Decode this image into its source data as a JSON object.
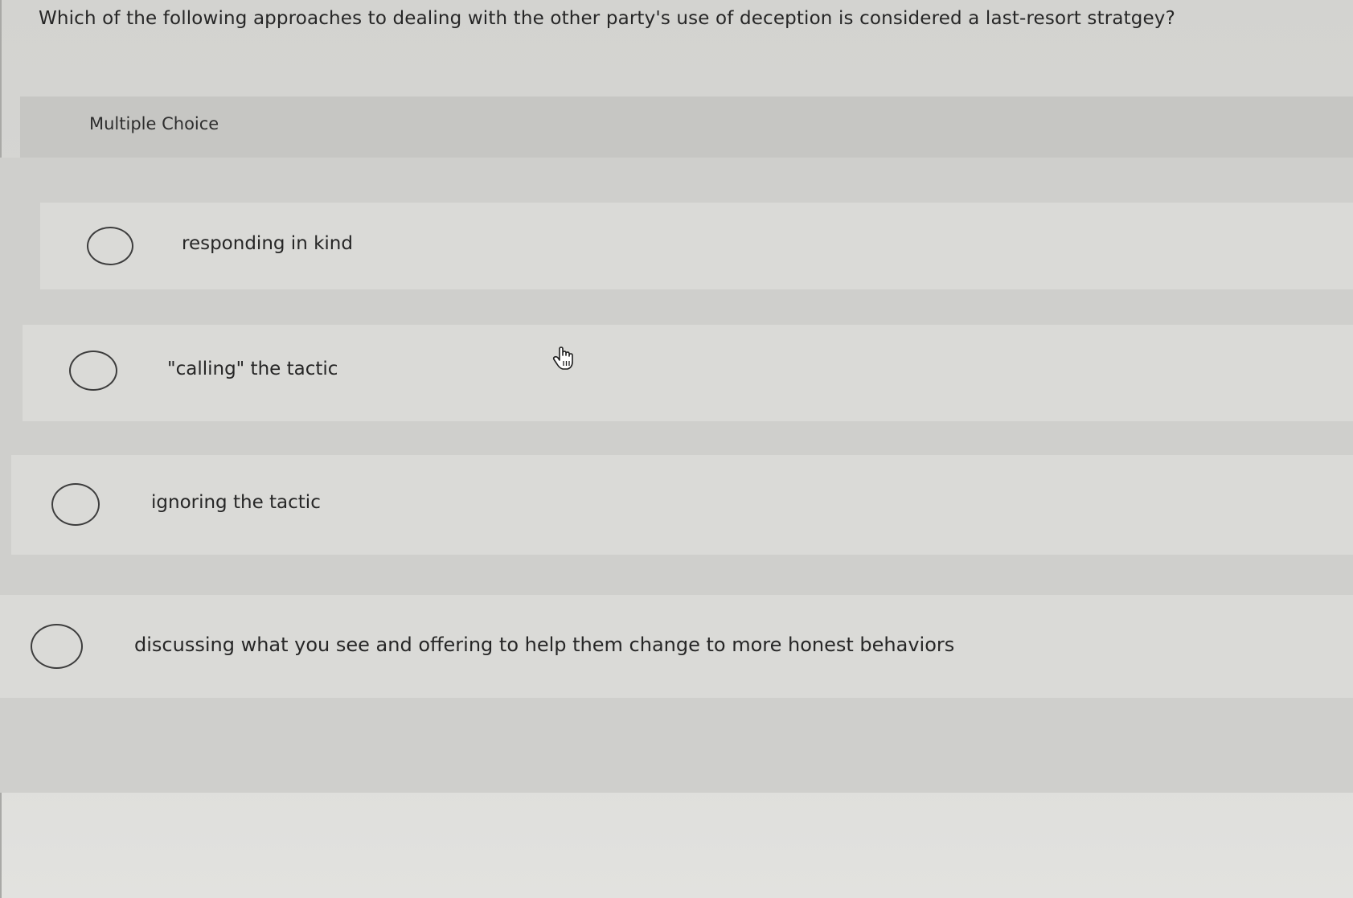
{
  "question": {
    "text": "Which of the following approaches to dealing with the other party's use of deception is considered a last-resort stratgey?"
  },
  "section": {
    "label": "Multiple Choice"
  },
  "options": [
    {
      "label": "responding in kind"
    },
    {
      "label": "\"calling\" the tactic"
    },
    {
      "label": "ignoring the tactic"
    },
    {
      "label": "discussing what you see and offering to help them change to more honest behaviors"
    }
  ],
  "cursor": {
    "icon": "hand-pointer-icon"
  }
}
